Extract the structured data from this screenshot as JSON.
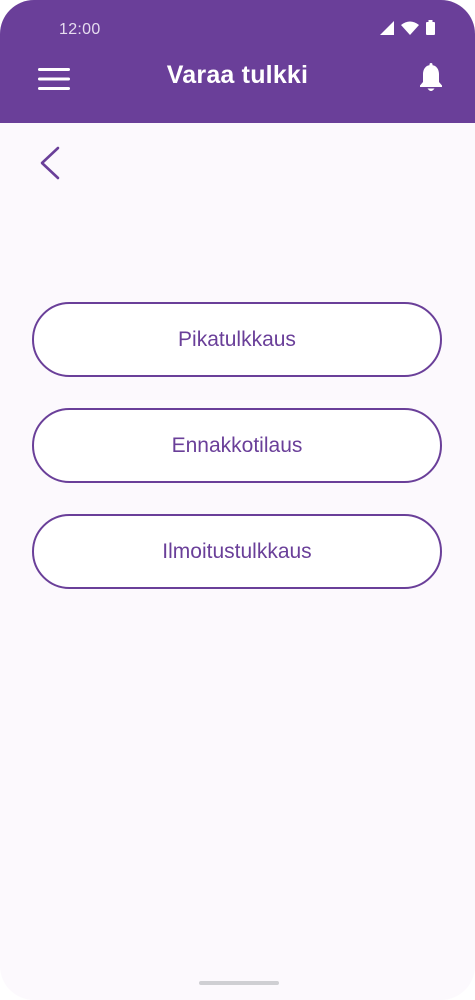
{
  "status_bar": {
    "time": "12:00",
    "icons": [
      "signal-icon",
      "wifi-icon",
      "battery-icon"
    ]
  },
  "header": {
    "title": "Varaa tulkki",
    "menu_icon": "hamburger-menu-icon",
    "notification_icon": "bell-icon"
  },
  "navigation": {
    "back_icon": "chevron-left-icon"
  },
  "options": [
    {
      "label": "Pikatulkkaus"
    },
    {
      "label": "Ennakkotilaus"
    },
    {
      "label": "Ilmoitustulkkaus"
    }
  ],
  "colors": {
    "primary": "#6a3f99",
    "background": "#fcf9fd",
    "on_primary": "#ffffff"
  }
}
